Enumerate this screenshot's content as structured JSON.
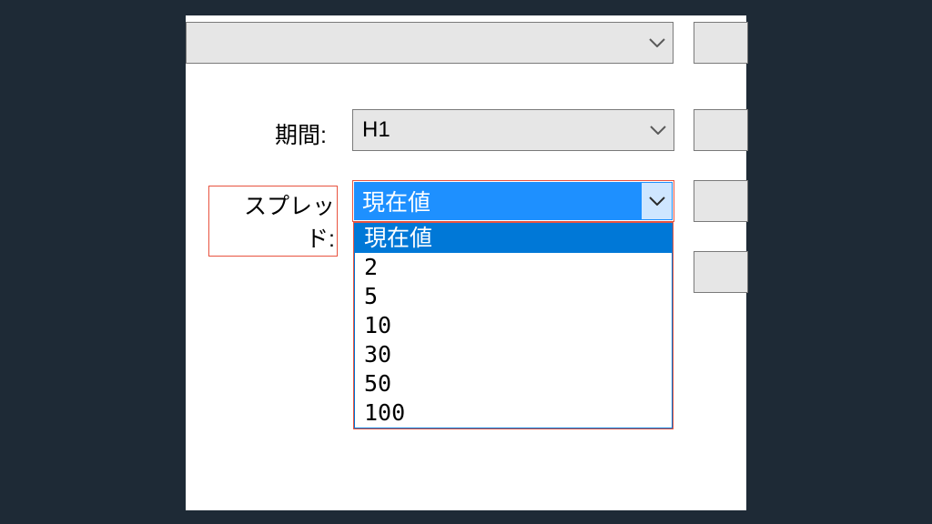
{
  "top_combo": {
    "value": ""
  },
  "row_period": {
    "label": "期間:",
    "value": "H1"
  },
  "row_spread": {
    "label": "スプレッド:",
    "value": "現在値",
    "options": [
      "現在値",
      "2",
      "5",
      "10",
      "30",
      "50",
      "100"
    ],
    "selected_index": 0
  }
}
